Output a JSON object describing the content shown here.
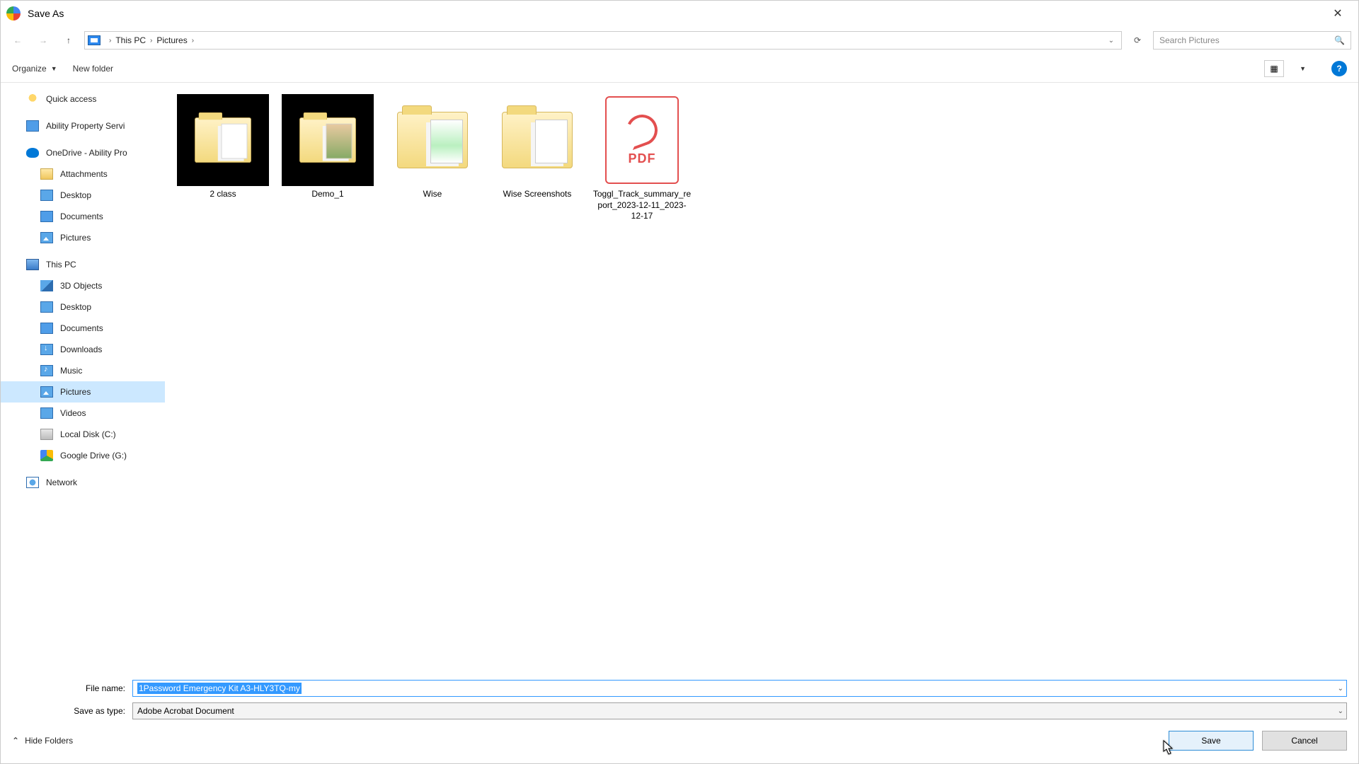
{
  "titlebar": {
    "title": "Save As"
  },
  "breadcrumb": {
    "root": "This PC",
    "current": "Pictures"
  },
  "search": {
    "placeholder": "Search Pictures"
  },
  "toolbar": {
    "organize": "Organize",
    "newFolder": "New folder"
  },
  "sidebar": {
    "quickAccess": "Quick access",
    "ability": "Ability Property Servi",
    "onedrive": "OneDrive - Ability Pro",
    "odChildren": {
      "attachments": "Attachments",
      "desktop": "Desktop",
      "documents": "Documents",
      "pictures": "Pictures"
    },
    "thisPC": "This PC",
    "pcChildren": {
      "objects3d": "3D Objects",
      "desktop": "Desktop",
      "documents": "Documents",
      "downloads": "Downloads",
      "music": "Music",
      "pictures": "Pictures",
      "videos": "Videos",
      "localDisk": "Local Disk (C:)",
      "gdrive": "Google Drive (G:)"
    },
    "network": "Network"
  },
  "files": {
    "f0": "2 class",
    "f1": "Demo_1",
    "f2": "Wise",
    "f3": "Wise Screenshots",
    "f4": "Toggl_Track_summary_report_2023-12-11_2023-12-17"
  },
  "pdfLabel": "PDF",
  "form": {
    "fileNameLabel": "File name:",
    "fileNameValue": "1Password Emergency Kit A3-HLY3TQ-my",
    "saveTypeLabel": "Save as type:",
    "saveTypeValue": "Adobe Acrobat Document"
  },
  "footer": {
    "hideFolders": "Hide Folders",
    "save": "Save",
    "cancel": "Cancel"
  }
}
